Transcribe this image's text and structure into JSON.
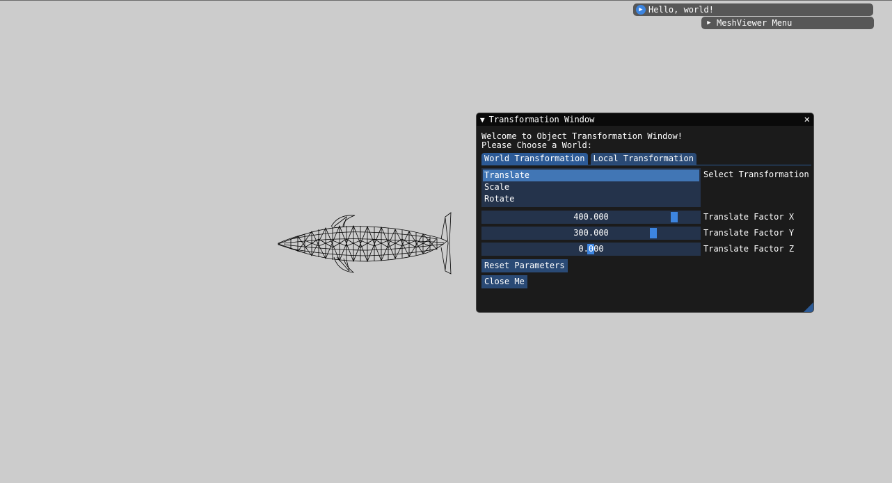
{
  "overlay": {
    "hello_window": {
      "label": "Hello, world!"
    },
    "menu_window": {
      "label": "MeshViewer Menu"
    }
  },
  "transform_window": {
    "title": "Transformation Window",
    "welcome": "Welcome to Object Transformation Window!",
    "prompt": "Please Choose a World:",
    "tabs": [
      {
        "label": "World Transformation",
        "active": true
      },
      {
        "label": "Local Transformation",
        "active": false
      }
    ],
    "transformations": [
      "Translate",
      "Scale",
      "Rotate"
    ],
    "selected_transformation": "Translate",
    "list_label": "Select Transformation",
    "sliders": [
      {
        "label": "Translate Factor X",
        "value": "400.000",
        "fraction": 0.88
      },
      {
        "label": "Translate Factor Y",
        "value": "300.000",
        "fraction": 0.79
      },
      {
        "label": "Translate Factor Z",
        "value": "0.000",
        "fraction": 0.5
      }
    ],
    "reset_button": "Reset Parameters",
    "close_button": "Close Me"
  },
  "colors": {
    "background": "#cccccc",
    "window_bg": "#141414",
    "accent": "#3d85e0",
    "frame": "#24334b"
  }
}
